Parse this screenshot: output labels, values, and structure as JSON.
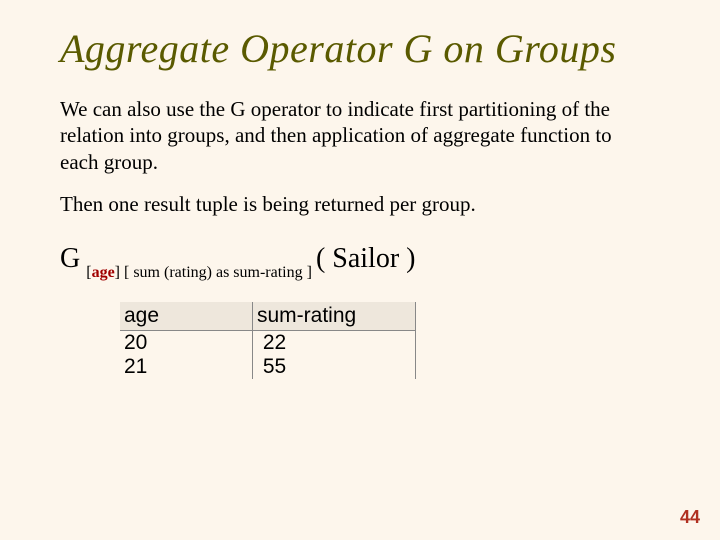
{
  "title": "Aggregate  Operator  G  on Groups",
  "para1": "We can also use the G operator to indicate first partitioning of the relation into groups, and then application of aggregate function to each group.",
  "para2": "Then one result tuple is being returned per group.",
  "expr": {
    "G": "G",
    "openBr1": "[",
    "groupKey": "age",
    "closeBr1": "]",
    "openBr2": " [ ",
    "aggSpec": "sum (rating)  as  sum-rating",
    "closeBr2": " ]",
    "relation": "( Sailor )"
  },
  "table": {
    "headers": {
      "age": "age",
      "sum": "sum-rating"
    },
    "rows": [
      {
        "age": "20",
        "sum": "22"
      },
      {
        "age": "21",
        "sum": "55"
      }
    ]
  },
  "pageNumber": "44"
}
